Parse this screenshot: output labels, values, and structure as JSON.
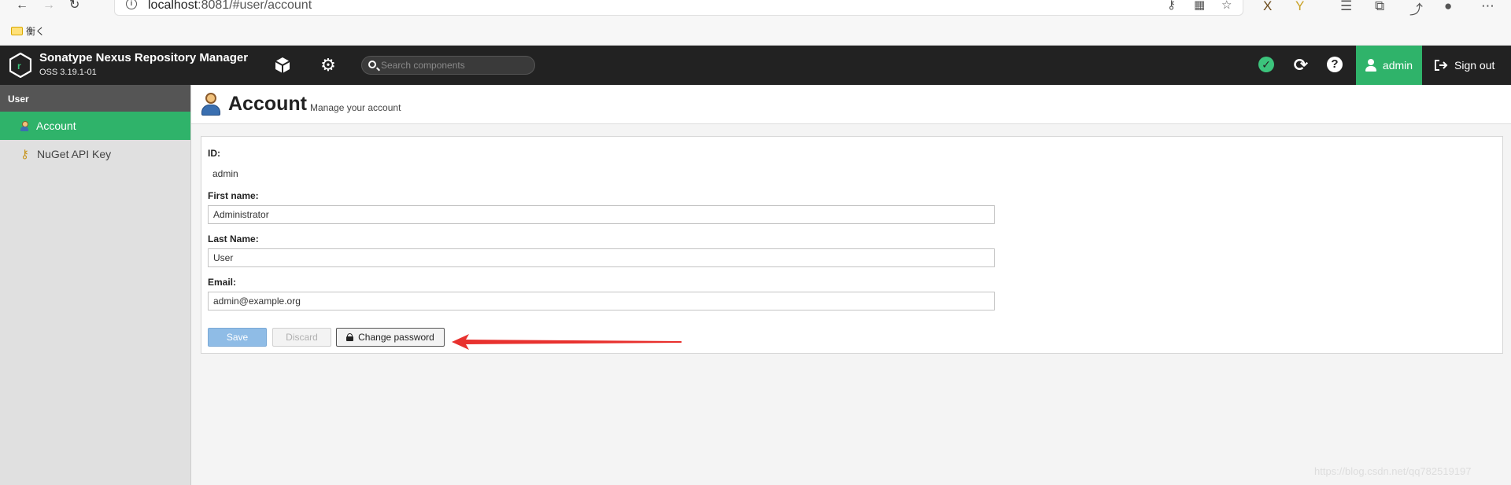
{
  "browser": {
    "url_host": "localhost",
    "url_rest": ":8081/#user/account",
    "bookmark_label": "衡く"
  },
  "header": {
    "brand_title": "Sonatype Nexus Repository Manager",
    "brand_version": "OSS 3.19.1-01",
    "search_placeholder": "Search components",
    "user_label": "admin",
    "signout_label": "Sign out"
  },
  "sidebar": {
    "section_title": "User",
    "items": [
      {
        "label": "Account",
        "active": true
      },
      {
        "label": "NuGet API Key",
        "active": false
      }
    ]
  },
  "page": {
    "title": "Account",
    "subtitle": "Manage your account"
  },
  "form": {
    "id_label": "ID:",
    "id_value": "admin",
    "first_name_label": "First name:",
    "first_name_value": "Administrator",
    "last_name_label": "Last Name:",
    "last_name_value": "User",
    "email_label": "Email:",
    "email_value": "admin@example.org",
    "save_label": "Save",
    "discard_label": "Discard",
    "change_password_label": "Change password"
  },
  "annotation": {
    "arrow_color": "#e8312e"
  },
  "colors": {
    "accent": "#2fb36a",
    "header_bg": "#222222"
  },
  "watermark": "https://blog.csdn.net/qq782519197"
}
